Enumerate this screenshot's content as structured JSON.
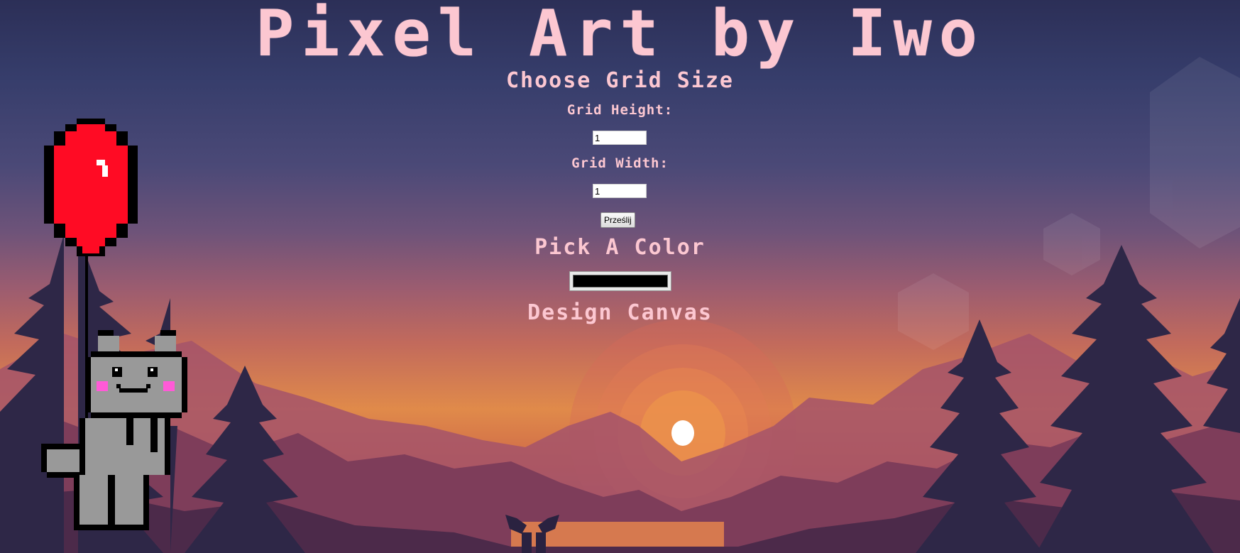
{
  "page": {
    "title": "Pixel Art by Iwo"
  },
  "grid_form": {
    "heading": "Choose Grid Size",
    "height_label": "Grid Height:",
    "height_value": "1",
    "width_label": "Grid Width:",
    "width_value": "1",
    "submit_label": "Prześlij"
  },
  "color_section": {
    "heading": "Pick A Color",
    "selected_color": "#000000"
  },
  "canvas_section": {
    "heading": "Design Canvas"
  },
  "decoration": {
    "image": "pixel-cat-with-red-balloon",
    "background": "sunset-mountains-forest"
  },
  "colors": {
    "text_accent": "#fcc7d1",
    "balloon": "#ff0b24",
    "cat_body": "#999999",
    "cat_cheeks": "#ff5ad7"
  }
}
